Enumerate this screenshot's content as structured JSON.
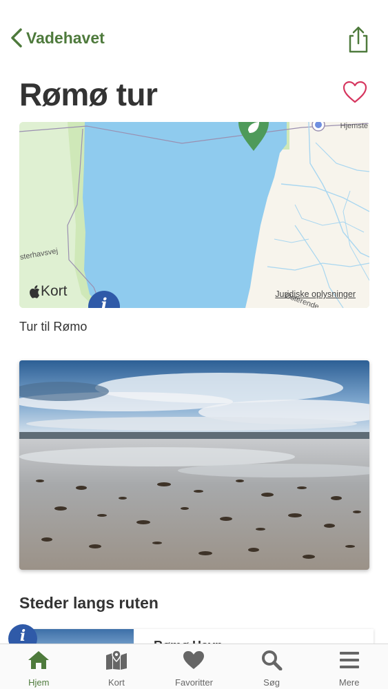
{
  "nav": {
    "back_label": "Vadehavet"
  },
  "page": {
    "title": "Rømø tur"
  },
  "map": {
    "road_label_left": "sterhavsvej",
    "road_label_right": "Hjemste",
    "road_label_bottom": "Østerende",
    "brand_label": "Kort",
    "legal_link": "Juridiske oplysninger",
    "caption": "Tur til Rømo"
  },
  "section": {
    "title": "Steder langs ruten"
  },
  "places": [
    {
      "name": "Rømø Havn"
    }
  ],
  "tabs": [
    {
      "label": "Hjem",
      "icon": "home-icon",
      "active": true
    },
    {
      "label": "Kort",
      "icon": "map-icon",
      "active": false
    },
    {
      "label": "Favoritter",
      "icon": "heart-icon",
      "active": false
    },
    {
      "label": "Søg",
      "icon": "search-icon",
      "active": false
    },
    {
      "label": "Mere",
      "icon": "menu-icon",
      "active": false
    }
  ],
  "colors": {
    "accent_green": "#4e7a3c",
    "favorite_pink": "#d6365f",
    "info_blue": "#2f5aa8",
    "water": "#8fcbee"
  }
}
